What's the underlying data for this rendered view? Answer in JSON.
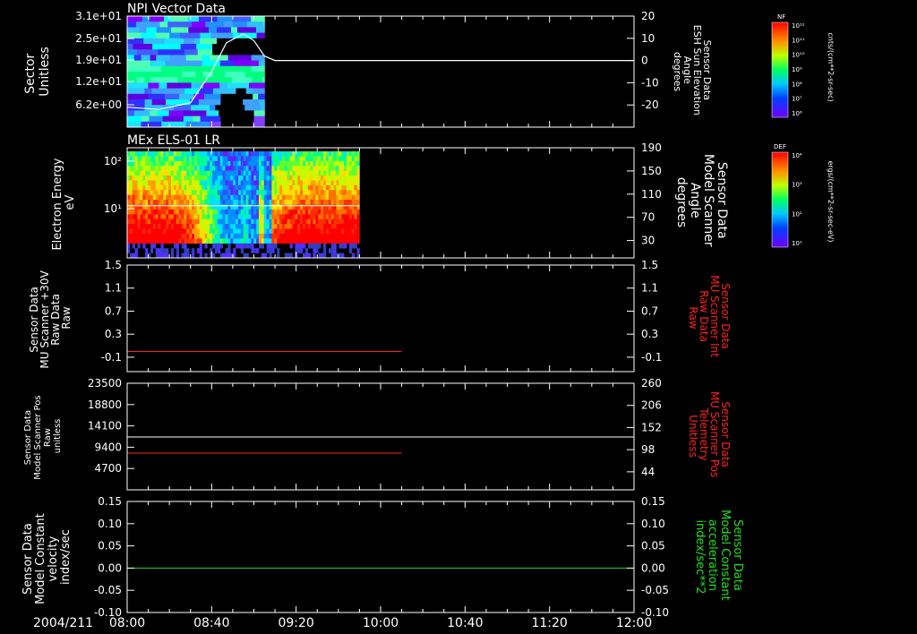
{
  "chart_data": [
    {
      "type": "heatmap",
      "title": "NPI Vector Data",
      "ylabel": [
        "Sector",
        "Unitless"
      ],
      "y_ticks": [
        "3.1e+01",
        "2.5e+01",
        "1.9e+01",
        "1.2e+01",
        "6.2e+00"
      ],
      "y2label": [
        "Sensor Data",
        "ESH Sun Elevation",
        "Angle",
        "degrees"
      ],
      "y2_ticks": [
        "20",
        "10",
        "0",
        "-10",
        "-20"
      ],
      "y2lim": [
        -30,
        20
      ],
      "data_extent": [
        "08:00",
        "09:05"
      ],
      "line_series": {
        "color": "#ffffff",
        "x": [
          "08:00",
          "08:15",
          "08:30",
          "08:40",
          "08:47",
          "08:55",
          "09:00",
          "09:05",
          "09:10",
          "12:00"
        ],
        "values": [
          -21,
          -22,
          -19,
          -5,
          8,
          12,
          9,
          2,
          0,
          0
        ]
      },
      "colorbar": {
        "label": "NF",
        "units": "cnts/(cm**2-sr-sec)",
        "ticks": [
          "10¹²",
          "10¹¹",
          "10¹⁰",
          "10⁹",
          "10⁸",
          "10⁷",
          "10⁶"
        ]
      }
    },
    {
      "type": "heatmap",
      "title": "MEx ELS-01 LR",
      "ylabel": [
        "Electron Energy",
        "eV"
      ],
      "y_ticks": [
        "10²",
        "10¹"
      ],
      "y2label": [
        "Sensor Data",
        "Model Scanner",
        "Angle",
        "degrees"
      ],
      "y2_ticks": [
        "190",
        "150",
        "110",
        "70",
        "30"
      ],
      "y2lim": [
        0,
        190
      ],
      "data_extent": [
        "08:00",
        "09:50"
      ],
      "line_series": {
        "color": "#ffffff",
        "x": [
          "08:00",
          "09:50"
        ],
        "values": [
          90,
          90
        ]
      },
      "colorbar": {
        "label": "DEF",
        "units": "ergs/(cm**2-sr-sec-eV)",
        "ticks": [
          "10⁴",
          "10³",
          "10²",
          "10¹"
        ]
      }
    },
    {
      "type": "line",
      "ylabel": [
        "Sensor Data",
        "MU Scanner +30V",
        "Raw Data",
        "Raw"
      ],
      "y_ticks": [
        "1.5",
        "1.1",
        "0.7",
        "0.3",
        "-0.1"
      ],
      "ylim": [
        -0.35,
        1.5
      ],
      "y2label": [
        "Sensor Data",
        "MU Scanner Int",
        "Raw Data",
        "Raw"
      ],
      "y2_ticks": [
        "1.5",
        "1.1",
        "0.7",
        "0.3",
        "-0.1"
      ],
      "series": [
        {
          "color": "#ff2020",
          "x": [
            "08:00",
            "10:10"
          ],
          "values": [
            0.0,
            0.0
          ]
        }
      ]
    },
    {
      "type": "line",
      "ylabel": [
        "Sensor Data",
        "Model Scanner Pos",
        "Raw",
        "unitless"
      ],
      "y_ticks": [
        "23500",
        "18800",
        "14100",
        "9400",
        "4700"
      ],
      "ylim": [
        0,
        23500
      ],
      "y2label": [
        "Sensor Data",
        "MU Scanner Pos",
        "Telemetry",
        "Unitless"
      ],
      "y2_ticks": [
        "260",
        "206",
        "152",
        "98",
        "44"
      ],
      "y2lim": [
        0,
        260
      ],
      "series": [
        {
          "color": "#ff2020",
          "axis": "left",
          "x": [
            "08:00",
            "10:10"
          ],
          "values": [
            8100,
            8100
          ]
        },
        {
          "color": "#ffffff",
          "axis": "left",
          "x": [
            "08:00",
            "12:00"
          ],
          "values": [
            11650,
            11650
          ]
        }
      ]
    },
    {
      "type": "line",
      "ylabel": [
        "Sensor Data",
        "Model Constant",
        "velocity",
        "index/sec"
      ],
      "y_ticks": [
        "0.15",
        "0.10",
        "0.05",
        "0.00",
        "-0.05",
        "-0.10"
      ],
      "ylim": [
        -0.1,
        0.15
      ],
      "y2label": [
        "Sensor Data",
        "Model Constant",
        "acceleration",
        "index/sec**2"
      ],
      "y2_ticks": [
        "0.15",
        "0.10",
        "0.05",
        "0.00",
        "-0.05",
        "-0.10"
      ],
      "series": [
        {
          "color": "#20e020",
          "x": [
            "08:00",
            "12:00"
          ],
          "values": [
            0.0,
            0.0
          ]
        }
      ]
    }
  ],
  "x_axis": {
    "date_label": "2004/211",
    "ticks": [
      "08:00",
      "08:40",
      "09:20",
      "10:00",
      "10:40",
      "11:20",
      "12:00"
    ],
    "range": [
      "08:00",
      "12:00"
    ]
  },
  "colors": {
    "frame": "#ffffff",
    "background": "#000000",
    "red_label": "#ff2020",
    "green_label": "#20e020"
  }
}
